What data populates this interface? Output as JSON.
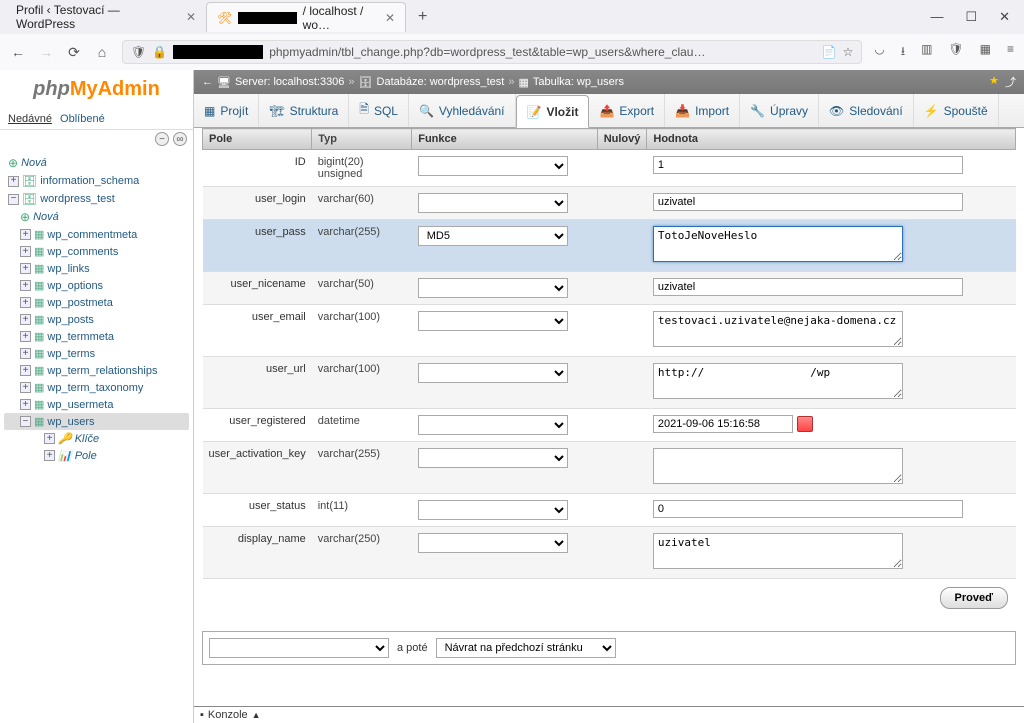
{
  "browser": {
    "tab1": "Profil ‹ Testovací — WordPress",
    "tab2_suffix": " / localhost / wo…",
    "url_prefix": "phpmyadmin/tbl_change.php?db=wordpress_test&table=wp_users&where_clau…"
  },
  "sidebar": {
    "recent": "Nedávné",
    "fav": "Oblíbené",
    "new": "Nová",
    "dbs": [
      "information_schema",
      "wordpress_test"
    ],
    "tables": [
      "wp_commentmeta",
      "wp_comments",
      "wp_links",
      "wp_options",
      "wp_postmeta",
      "wp_posts",
      "wp_termmeta",
      "wp_terms",
      "wp_term_relationships",
      "wp_term_taxonomy",
      "wp_usermeta",
      "wp_users"
    ],
    "sub": [
      "Klíče",
      "Pole"
    ]
  },
  "bc": {
    "server": "Server: localhost:3306",
    "db": "Databáze: wordpress_test",
    "table": "Tabulka: wp_users"
  },
  "tabs": [
    "Projít",
    "Struktura",
    "SQL",
    "Vyhledávání",
    "Vložit",
    "Export",
    "Import",
    "Úpravy",
    "Sledování",
    "Spouště"
  ],
  "hdr": {
    "field": "Pole",
    "type": "Typ",
    "func": "Funkce",
    "null": "Nulový",
    "val": "Hodnota"
  },
  "rows": [
    {
      "field": "ID",
      "type": "bigint(20) unsigned",
      "func": "",
      "val": "1",
      "ctrl": "short"
    },
    {
      "field": "user_login",
      "type": "varchar(60)",
      "func": "",
      "val": "uzivatel",
      "ctrl": "input"
    },
    {
      "field": "user_pass",
      "type": "varchar(255)",
      "func": "MD5",
      "val": "TotoJeNoveHeslo",
      "ctrl": "textarea",
      "hl": true
    },
    {
      "field": "user_nicename",
      "type": "varchar(50)",
      "func": "",
      "val": "uzivatel",
      "ctrl": "med"
    },
    {
      "field": "user_email",
      "type": "varchar(100)",
      "func": "",
      "val": "testovaci.uzivatele@nejaka-domena.cz",
      "ctrl": "textarea"
    },
    {
      "field": "user_url",
      "type": "varchar(100)",
      "func": "",
      "val": "http://██████████████/wp",
      "ctrl": "textarea",
      "redact": true
    },
    {
      "field": "user_registered",
      "type": "datetime",
      "func": "",
      "val": "2021-09-06 15:16:58",
      "ctrl": "date"
    },
    {
      "field": "user_activation_key",
      "type": "varchar(255)",
      "func": "",
      "val": "",
      "ctrl": "textarea"
    },
    {
      "field": "user_status",
      "type": "int(11)",
      "func": "",
      "val": "0",
      "ctrl": "short"
    },
    {
      "field": "display_name",
      "type": "varchar(250)",
      "func": "",
      "val": "uzivatel",
      "ctrl": "textarea"
    }
  ],
  "submit": "Proveď",
  "bottom": {
    "then": "a poté",
    "return": "Návrat na předchozí stránku"
  },
  "console": "Konzole"
}
